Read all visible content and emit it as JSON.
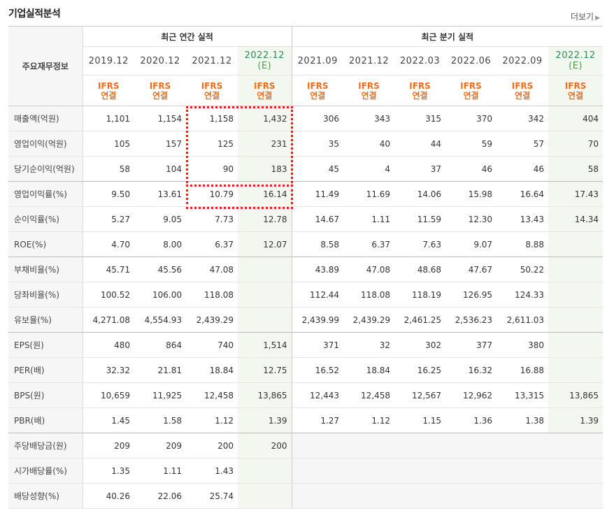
{
  "title": "기업실적분석",
  "more_label": "더보기",
  "row_header": "주요재무정보",
  "annual_header": "최근 연간 실적",
  "quarter_header": "최근 분기 실적",
  "ifrs_top": "IFRS",
  "ifrs_bottom": "연결",
  "periods": [
    {
      "label": "2019.12",
      "est": ""
    },
    {
      "label": "2020.12",
      "est": ""
    },
    {
      "label": "2021.12",
      "est": ""
    },
    {
      "label": "2022.12",
      "est": "(E)"
    },
    {
      "label": "2021.09",
      "est": ""
    },
    {
      "label": "2021.12",
      "est": ""
    },
    {
      "label": "2022.03",
      "est": ""
    },
    {
      "label": "2022.06",
      "est": ""
    },
    {
      "label": "2022.09",
      "est": ""
    },
    {
      "label": "2022.12",
      "est": "(E)"
    }
  ],
  "rows": [
    {
      "label": "매출액(억원)",
      "values": [
        "1,101",
        "1,154",
        "1,158",
        "1,432",
        "306",
        "343",
        "315",
        "370",
        "342",
        "404"
      ]
    },
    {
      "label": "영업이익(억원)",
      "values": [
        "105",
        "157",
        "125",
        "231",
        "35",
        "40",
        "44",
        "59",
        "57",
        "70"
      ]
    },
    {
      "label": "당기순이익(억원)",
      "values": [
        "58",
        "104",
        "90",
        "183",
        "45",
        "4",
        "37",
        "46",
        "46",
        "58"
      ]
    },
    {
      "label": "영업이익률(%)",
      "values": [
        "9.50",
        "13.61",
        "10.79",
        "16.14",
        "11.49",
        "11.69",
        "14.06",
        "15.98",
        "16.64",
        "17.43"
      ]
    },
    {
      "label": "순이익률(%)",
      "values": [
        "5.27",
        "9.05",
        "7.73",
        "12.78",
        "14.67",
        "1.11",
        "11.59",
        "12.30",
        "13.43",
        "14.34"
      ]
    },
    {
      "label": "ROE(%)",
      "values": [
        "4.70",
        "8.00",
        "6.37",
        "12.07",
        "8.58",
        "6.37",
        "7.63",
        "9.07",
        "8.88",
        ""
      ]
    },
    {
      "label": "부채비율(%)",
      "values": [
        "45.71",
        "45.56",
        "47.08",
        "",
        "43.89",
        "47.08",
        "48.68",
        "47.67",
        "50.22",
        ""
      ]
    },
    {
      "label": "당좌비율(%)",
      "values": [
        "100.52",
        "106.00",
        "118.08",
        "",
        "112.44",
        "118.08",
        "118.19",
        "126.95",
        "124.33",
        ""
      ]
    },
    {
      "label": "유보율(%)",
      "values": [
        "4,271.08",
        "4,554.93",
        "2,439.29",
        "",
        "2,439.99",
        "2,439.29",
        "2,461.25",
        "2,536.23",
        "2,611.03",
        ""
      ]
    },
    {
      "label": "EPS(원)",
      "values": [
        "480",
        "864",
        "740",
        "1,514",
        "371",
        "32",
        "302",
        "377",
        "380",
        ""
      ]
    },
    {
      "label": "PER(배)",
      "values": [
        "32.32",
        "21.81",
        "18.84",
        "12.75",
        "16.52",
        "18.84",
        "16.25",
        "16.32",
        "16.88",
        ""
      ]
    },
    {
      "label": "BPS(원)",
      "values": [
        "10,659",
        "11,925",
        "12,458",
        "13,865",
        "12,443",
        "12,458",
        "12,567",
        "12,962",
        "13,315",
        "13,865"
      ]
    },
    {
      "label": "PBR(배)",
      "values": [
        "1.45",
        "1.58",
        "1.12",
        "1.39",
        "1.27",
        "1.12",
        "1.15",
        "1.36",
        "1.38",
        "1.39"
      ]
    },
    {
      "label": "주당배당금(원)",
      "values": [
        "209",
        "209",
        "200",
        "200",
        "",
        "",
        "",
        "",
        "",
        ""
      ]
    },
    {
      "label": "시가배당률(%)",
      "values": [
        "1.35",
        "1.11",
        "1.43",
        "",
        "",
        "",
        "",
        "",
        "",
        ""
      ]
    },
    {
      "label": "배당성향(%)",
      "values": [
        "40.26",
        "22.06",
        "25.74",
        "",
        "",
        "",
        "",
        "",
        "",
        ""
      ]
    }
  ]
}
